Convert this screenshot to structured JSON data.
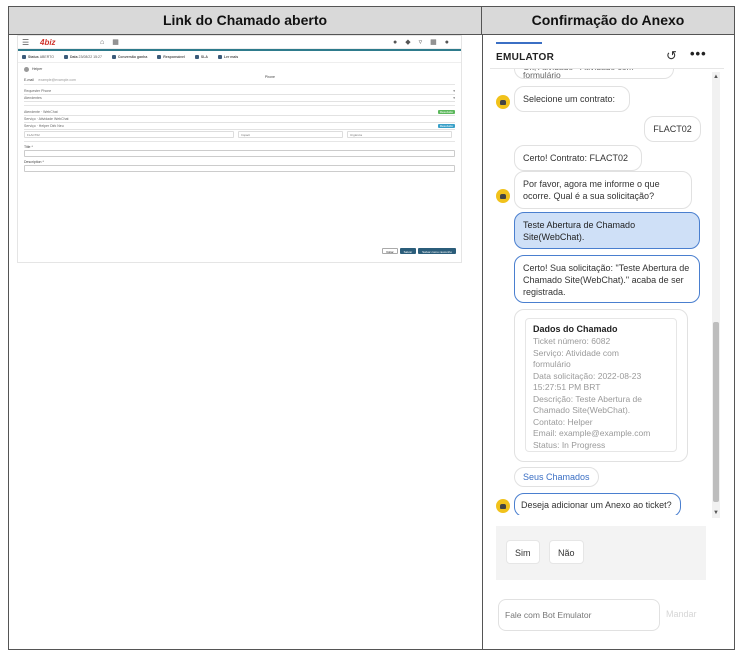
{
  "headers": {
    "left": "Link do Chamado aberto",
    "right": "Confirmação do Anexo"
  },
  "mini": {
    "logo": "4biz",
    "tabs": [
      {
        "label": "Status",
        "sub": "ABERTO"
      },
      {
        "label": "Data",
        "sub": "23/08/22 15:27"
      },
      {
        "label": "Conversão ganha",
        "sub": ""
      },
      {
        "label": "Responsável",
        "sub": ""
      },
      {
        "label": "SLA",
        "sub": ""
      },
      {
        "label": "Ler mais",
        "sub": ""
      }
    ],
    "contact_name": "Helper",
    "contact_email": "example@example.com",
    "email_label": "E-mail",
    "phone_label": "Phone",
    "fields": [
      {
        "label": "Requester Phone",
        "value": ""
      },
      {
        "label": "Atendentes",
        "value": ""
      }
    ],
    "items": [
      {
        "label": "Atendente",
        "sub": "WebChat",
        "badge": "Resolvido",
        "badge_color": "#5cb85c"
      },
      {
        "label": "Serviço",
        "sub": "Atividade WebChat",
        "badge": "",
        "badge_color": ""
      },
      {
        "label": "Serviço",
        "sub": "Helper Dirk Neu",
        "badge": "Resolvido",
        "badge_color": "#39a0c8"
      }
    ],
    "selects": [
      "FLACT02",
      "Impact",
      "Urgência"
    ],
    "title_label": "Title *",
    "description_label": "Description *",
    "buttons": [
      "Voltar",
      "Salvar",
      "Salvar como rascunho"
    ]
  },
  "emulator": {
    "title": "EMULATOR",
    "restart_icon": "restart-icon",
    "more_icon": "more-icon",
    "messages": {
      "m0": "Ok, Atividade - Atividade com formulário",
      "m1": "Selecione um contrato:",
      "m2": "FLACT02",
      "m3": "Certo! Contrato:  FLACT02",
      "m4": "Por favor, agora me informe o que ocorre. Qual é a sua solicitação?",
      "m5": "Teste Abertura de Chamado Site(WebChat).",
      "m6": "Certo! Sua solicitação: \"Teste Abertura de Chamado Site(WebChat).\" acaba de ser registrada.",
      "m7": "Deseja adicionar um Anexo ao ticket?"
    },
    "card": {
      "title": "Dados do Chamado",
      "lines": [
        "Ticket número: 6082",
        "Serviço: Atividade com",
        "formulário",
        "Data solicitação: 2022-08-23",
        "15:27:51 PM BRT",
        "Descrição: Teste Abertura de",
        "Chamado Site(WebChat).",
        "Contato: Helper",
        "Email: example@example.com",
        "Status: In Progress"
      ]
    },
    "card_action": "Seus Chamados",
    "suggested": [
      "Sim",
      "Não"
    ],
    "input_placeholder": "Fale com Bot Emulator",
    "send_label": "Mandar"
  }
}
